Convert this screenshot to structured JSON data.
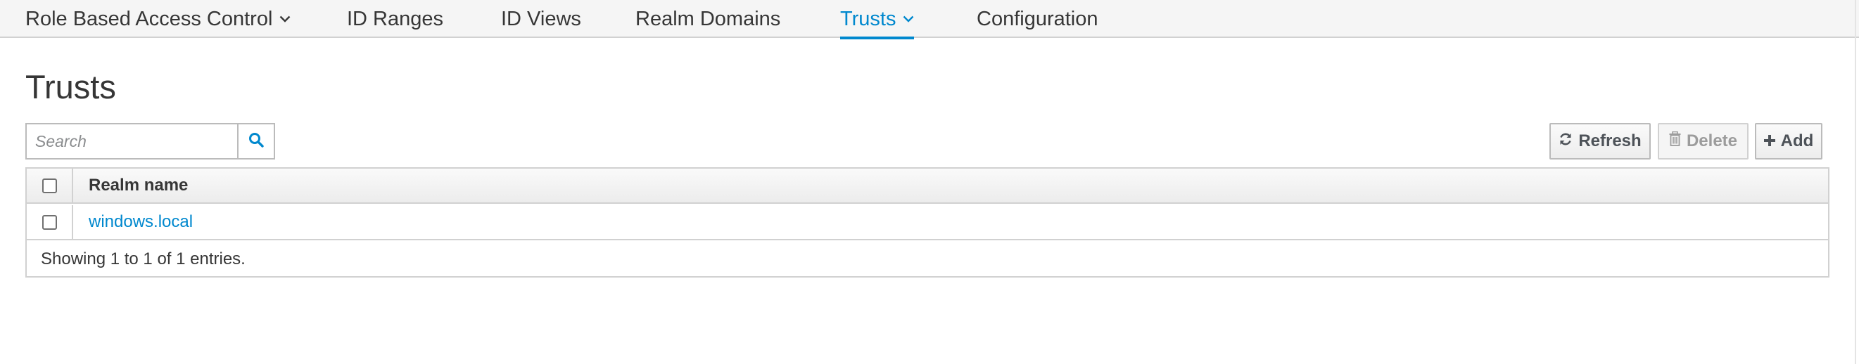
{
  "nav": {
    "items": [
      {
        "label": "Role Based Access Control",
        "has_dropdown": true,
        "active": false
      },
      {
        "label": "ID Ranges",
        "has_dropdown": false,
        "active": false
      },
      {
        "label": "ID Views",
        "has_dropdown": false,
        "active": false
      },
      {
        "label": "Realm Domains",
        "has_dropdown": false,
        "active": false
      },
      {
        "label": "Trusts",
        "has_dropdown": true,
        "active": true
      },
      {
        "label": "Configuration",
        "has_dropdown": false,
        "active": false
      }
    ],
    "active_color": "#0088ce"
  },
  "page": {
    "title": "Trusts"
  },
  "search": {
    "placeholder": "Search",
    "value": "",
    "icon": "search-icon"
  },
  "toolbar": {
    "refresh_label": "Refresh",
    "refresh_icon": "refresh-icon",
    "delete_label": "Delete",
    "delete_icon": "trash-icon",
    "delete_disabled": true,
    "add_label": "Add",
    "add_icon": "plus-icon"
  },
  "table": {
    "columns": [
      "Realm name"
    ],
    "rows": [
      {
        "realm_name": "windows.local",
        "checked": false
      }
    ],
    "footer": "Showing 1 to 1 of 1 entries."
  }
}
